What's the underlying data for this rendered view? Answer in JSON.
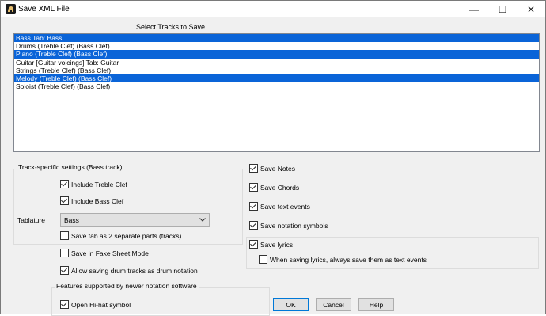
{
  "window": {
    "title": "Save XML File",
    "minimize": "—",
    "maximize": "☐",
    "close": "✕"
  },
  "tracks": {
    "label": "Select Tracks to Save",
    "items": [
      {
        "label": "Bass Tab: Bass",
        "selected": true
      },
      {
        "label": "Drums (Treble Clef) (Bass Clef)",
        "selected": false
      },
      {
        "label": "Piano (Treble Clef) (Bass Clef)",
        "selected": true
      },
      {
        "label": "Guitar [Guitar voicings] Tab: Guitar",
        "selected": false
      },
      {
        "label": "Strings (Treble Clef) (Bass Clef)",
        "selected": false
      },
      {
        "label": "Melody (Treble Clef) (Bass Clef)",
        "selected": true
      },
      {
        "label": "Soloist (Treble Clef) (Bass Clef)",
        "selected": false
      }
    ]
  },
  "track_settings": {
    "title": "Track-specific settings (Bass track)",
    "include_treble": {
      "label": "Include Treble Clef",
      "checked": true
    },
    "include_bass": {
      "label": "Include Bass Clef",
      "checked": true
    },
    "tablature_label": "Tablature",
    "tablature_value": "Bass",
    "separate_parts": {
      "label": "Save tab as 2 separate parts (tracks)",
      "checked": false
    }
  },
  "options": {
    "fake_sheet": {
      "label": "Save in Fake Sheet Mode",
      "checked": false
    },
    "drum_tracks": {
      "label": "Allow saving drum tracks as drum notation",
      "checked": true
    }
  },
  "features": {
    "title": "Features supported by newer notation software",
    "open_hihat": {
      "label": "Open Hi-hat symbol",
      "checked": true
    }
  },
  "right_options": {
    "save_notes": {
      "label": "Save Notes",
      "checked": true
    },
    "save_chords": {
      "label": "Save Chords",
      "checked": true
    },
    "save_text": {
      "label": "Save text events",
      "checked": true
    },
    "save_notation": {
      "label": "Save notation symbols",
      "checked": true
    },
    "save_lyrics": {
      "label": "Save lyrics",
      "checked": true
    },
    "lyrics_as_text": {
      "label": "When saving lyrics, always save them as text events",
      "checked": false
    }
  },
  "buttons": {
    "ok": "OK",
    "cancel": "Cancel",
    "help": "Help"
  }
}
